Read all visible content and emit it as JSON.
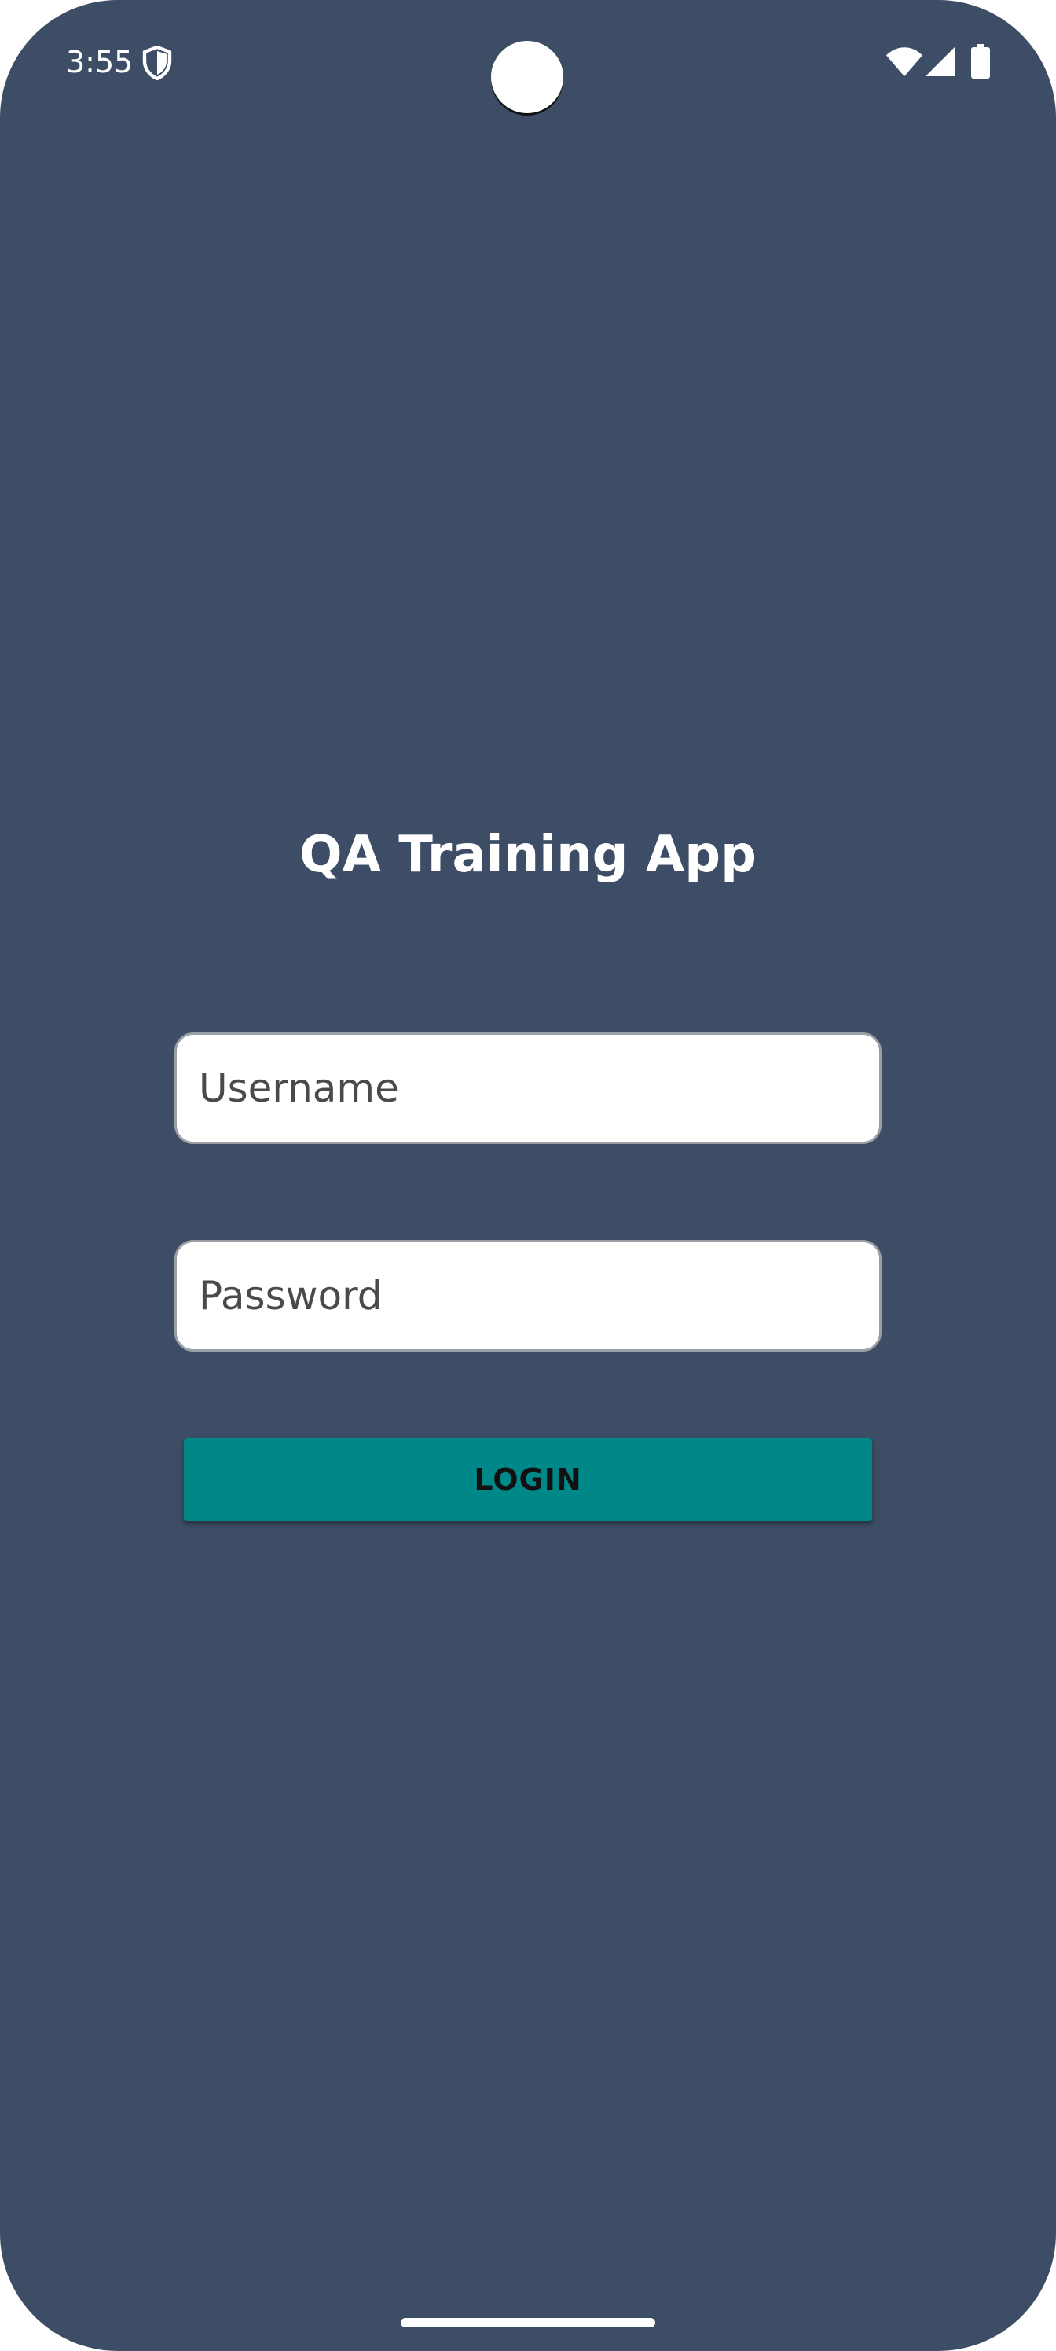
{
  "status_bar": {
    "time": "3:55",
    "icons": [
      "shield-icon",
      "wifi-icon",
      "signal-icon",
      "battery-icon"
    ]
  },
  "app": {
    "title": "QA Training App"
  },
  "login_form": {
    "username_placeholder": "Username",
    "username_value": "",
    "password_placeholder": "Password",
    "password_value": "",
    "login_label": "LOGIN"
  },
  "colors": {
    "background": "#3d4d66",
    "button": "#008787",
    "field": "#ffffff",
    "text_light": "#ffffff"
  }
}
